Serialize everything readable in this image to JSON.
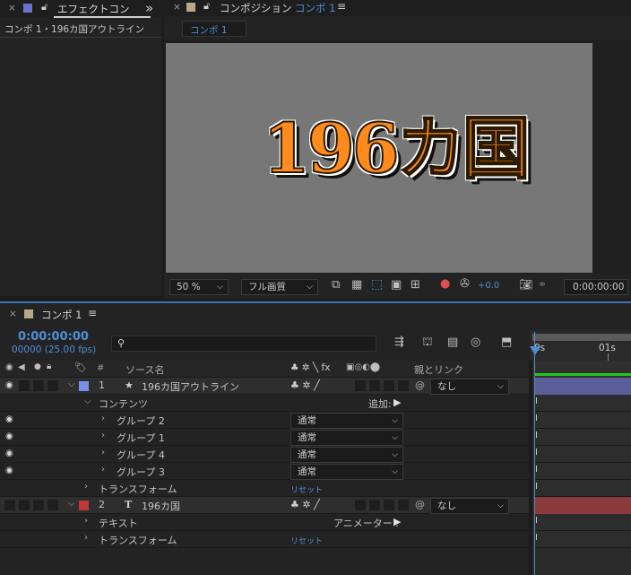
{
  "effects_panel": {
    "close": "×",
    "tab_title": "エフェクトコン",
    "expand": "»",
    "subtitle": "コンポ 1・196カ国アウトライン"
  },
  "comp_panel": {
    "close": "×",
    "tab_prefix": "コンポジション",
    "tab_name": "コンポ 1",
    "menu": "≡",
    "inner_tab": "コンポ 1",
    "canvas_text": "196カ国",
    "zoom": "50 %",
    "quality": "フル画質",
    "exposure": "+0.0",
    "timecode": "0:00:00:00"
  },
  "timeline": {
    "close": "×",
    "tab_name": "コンポ 1",
    "menu": "≡",
    "timecode": "0:00:00:00",
    "frames": "00000 (25.00 fps)",
    "search_placeholder": "",
    "hash_header": "#",
    "source_header": "ソース名",
    "switch_header": "♣ ✲ ╲ fx",
    "parent_header": "親とリンク",
    "ruler_0": "0s",
    "ruler_1": "01s",
    "rows": [
      {
        "num": "1",
        "star": "★",
        "name": "196カ国アウトライン",
        "switches": "♣ ✲ ╱",
        "parent": "なし"
      },
      {
        "name": "コンテンツ",
        "add_label": "追加:"
      },
      {
        "name": "グループ 2",
        "mode": "通常"
      },
      {
        "name": "グループ 1",
        "mode": "通常"
      },
      {
        "name": "グループ 4",
        "mode": "通常"
      },
      {
        "name": "グループ 3",
        "mode": "通常"
      },
      {
        "name": "トランスフォーム",
        "reset": "リセット"
      },
      {
        "num": "2",
        "type": "T",
        "name": "196カ国",
        "switches": "♣ ✲ ╱",
        "parent": "なし"
      },
      {
        "name": "テキスト",
        "animator": "アニメーター :"
      },
      {
        "name": "トランスフォーム",
        "reset": "リセット"
      }
    ]
  },
  "colors": {
    "layer1_label": "#7a8fe8",
    "layer2_label": "#c03838",
    "layer1_bar": "#5a5f9a",
    "layer2_bar": "#8a3a3a",
    "accent_blue": "#4d8fd6"
  }
}
